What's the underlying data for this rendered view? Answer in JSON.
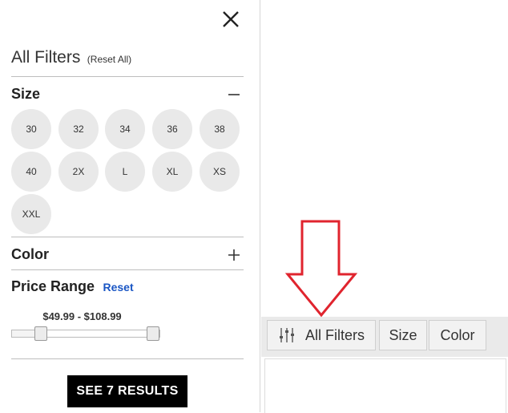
{
  "filters": {
    "title": "All Filters",
    "reset_all": "(Reset All)",
    "size_section": {
      "label": "Size",
      "options": [
        "30",
        "32",
        "34",
        "36",
        "38",
        "40",
        "2X",
        "L",
        "XL",
        "XS",
        "XXL"
      ]
    },
    "color_section": {
      "label": "Color"
    },
    "price_section": {
      "label": "Price Range",
      "reset": "Reset",
      "range_text": "$49.99 - $108.99"
    },
    "see_results": "SEE 7 RESULTS"
  },
  "toolbar": {
    "all_filters": "All Filters",
    "size": "Size",
    "color": "Color"
  },
  "colors": {
    "arrow": "#e0242e",
    "reset_link": "#1a56c4"
  },
  "icons": [
    "close-icon",
    "minus-icon",
    "plus-icon",
    "sliders-icon",
    "arrow-down-icon"
  ]
}
